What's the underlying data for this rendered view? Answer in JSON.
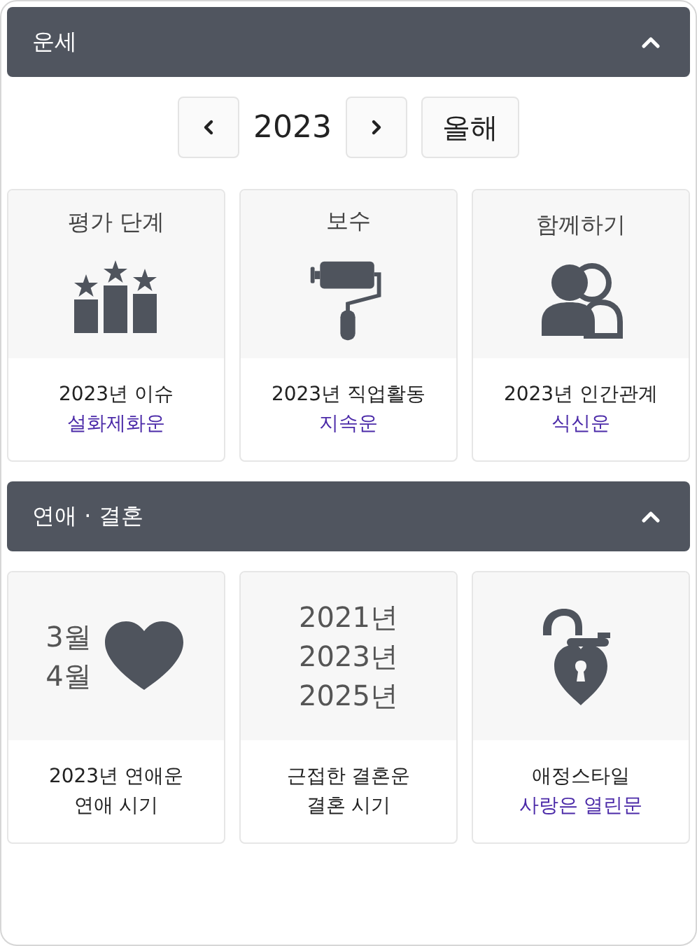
{
  "sections": [
    {
      "title": "운세",
      "expanded": true,
      "year_nav": {
        "year": "2023",
        "today_button": "올해"
      },
      "cards": [
        {
          "kind": "podium",
          "title": "평가 단계",
          "caption": [
            {
              "text": "2023년 이슈",
              "highlight": false
            },
            {
              "text": "설화제화운",
              "highlight": true
            }
          ]
        },
        {
          "kind": "roller",
          "title": "보수",
          "caption": [
            {
              "text": "2023년 직업활동",
              "highlight": false
            },
            {
              "text": "지속운",
              "highlight": true
            }
          ]
        },
        {
          "kind": "people",
          "title": "함께하기",
          "caption": [
            {
              "text": "2023년 인간관계",
              "highlight": false
            },
            {
              "text": "식신운",
              "highlight": true
            }
          ]
        }
      ]
    },
    {
      "title": "연애 · 결혼",
      "expanded": true,
      "cards": [
        {
          "kind": "months",
          "lines": [
            "3월",
            "4월"
          ],
          "caption": [
            {
              "text": "2023년 연애운",
              "highlight": false
            },
            {
              "text": "연애 시기",
              "highlight": false
            }
          ]
        },
        {
          "kind": "years",
          "lines": [
            "2021년",
            "2023년",
            "2025년"
          ],
          "caption": [
            {
              "text": "근접한 결혼운",
              "highlight": false
            },
            {
              "text": "결혼 시기",
              "highlight": false
            }
          ]
        },
        {
          "kind": "lockheart",
          "caption": [
            {
              "text": "애정스타일",
              "highlight": false
            },
            {
              "text": "사랑은 열린문",
              "highlight": true
            }
          ]
        }
      ]
    }
  ]
}
